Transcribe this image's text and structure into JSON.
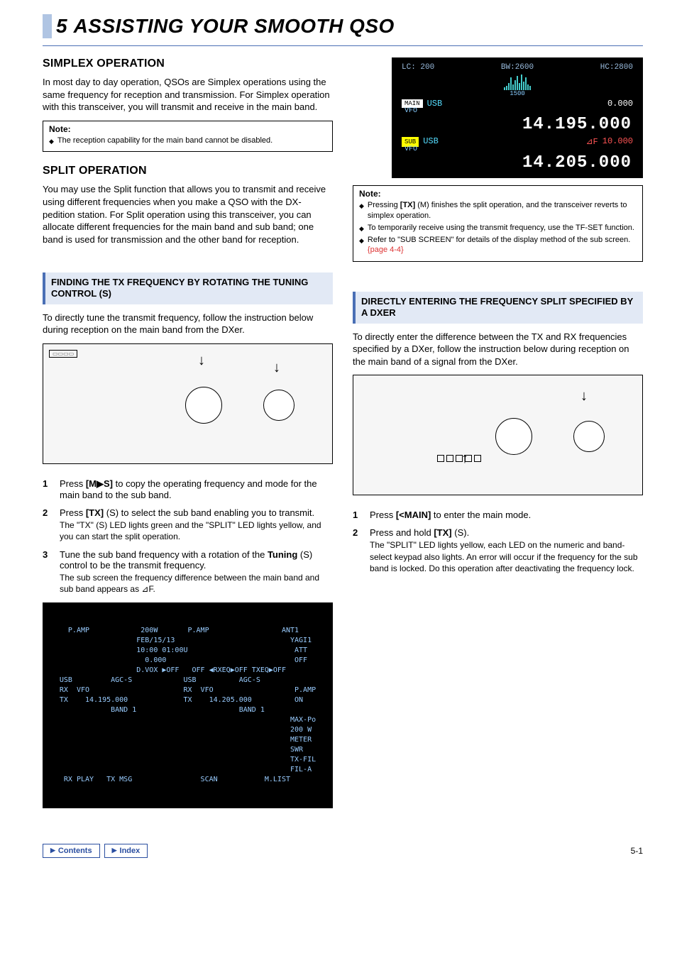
{
  "chapter": {
    "num": "5",
    "title": "ASSISTING YOUR SMOOTH QSO"
  },
  "left": {
    "sec1": {
      "title": "SIMPLEX OPERATION",
      "para": "In most day to day operation, QSOs are Simplex operations using the same frequency for reception and transmission. For Simplex operation with this transceiver, you will transmit and receive in the main band.",
      "note_title": "Note:",
      "note1": "The reception capability for the main band cannot be disabled."
    },
    "sec2": {
      "title": "SPLIT OPERATION",
      "para": "You may use the Split function that allows you to transmit and receive using different frequencies when you make a QSO with the DX-pedition station. For Split operation using this transceiver, you can allocate different frequencies for the main band and sub band; one band is used for transmission and the other band for reception."
    },
    "sub1": {
      "title": "FINDING THE TX FREQUENCY BY ROTATING THE TUNING CONTROL (S)",
      "para": "To directly tune the transmit frequency, follow the instruction below during reception on the main band from the DXer."
    },
    "step1": {
      "n": "1",
      "t1": "Press ",
      "key": "[M▶S]",
      "t2": " to copy the operating frequency and mode for the main band to the sub band."
    },
    "step2": {
      "n": "2",
      "t1": "Press ",
      "key": "[TX]",
      "t2": " (S) to select the sub band enabling you to transmit.",
      "sub": "The \"TX\" (S) LED lights green and the \"SPLIT\" LED lights yellow, and you can start the split operation."
    },
    "step3": {
      "n": "3",
      "t1": "Tune the sub band frequency with a rotation of the ",
      "key": "Tuning",
      "t2": " (S) control to be the transmit frequency.",
      "sub": "The sub screen the frequency difference between the main band and sub band appears as ⊿F."
    }
  },
  "lcd": {
    "top1": "LC: 200",
    "top2": "BW:2600",
    "top3": "HC:2800",
    "tick": "1500",
    "main_tag": "MAIN",
    "sub_tag": "SUB",
    "mode": "USB",
    "vfo": "VFO",
    "main_right": "0.000",
    "main_freq": "14.195.000",
    "df_lbl": "⊿F",
    "df_val": "10.000",
    "sub_freq": "14.205.000"
  },
  "right": {
    "note_title": "Note:",
    "note1a": "Pressing ",
    "note1_key": "[TX]",
    "note1b": " (M) finishes the split operation, and the transceiver reverts to simplex operation.",
    "note2": "To temporarily receive using the transmit frequency, use the TF-SET function.",
    "note3a": "Refer to \"SUB SCREEN\" for details of the display method of the sub screen. ",
    "note3_ref": "{page 4-4}",
    "sub2": {
      "title": "DIRECTLY ENTERING THE FREQUENCY SPLIT SPECIFIED BY A DXER",
      "para": "To directly enter the difference between the TX and RX frequencies specified by a DXer, follow the instruction below during reception on the main band of a signal from the DXer."
    },
    "step1": {
      "n": "1",
      "t1": "Press ",
      "key": "[<MAIN]",
      "t2": " to enter the main mode."
    },
    "step2": {
      "n": "2",
      "t1": "Press and hold ",
      "key": "[TX]",
      "t2": " (S).",
      "sub": "The \"SPLIT\" LED lights yellow, each LED on the numeric and band-select keypad also lights. An error will occur if the frequency for the sub band is locked. Do this operation after deactivating the frequency lock."
    }
  },
  "screen": {
    "txt": "  P.AMP            200W       P.AMP                 ANT1\n                  FEB/15/13                           YAGI1\n                  10:00 01:00U                         ATT\n                    0.000                              OFF\n                  D.VOX ▶OFF   OFF ◀RXEQ▶OFF TXEQ▶OFF\nUSB         AGC-S            USB          AGC-S\nRX  VFO                      RX  VFO                   P.AMP\nTX    14.195.000             TX    14.205.000          ON\n            BAND 1                        BAND 1\n                                                      MAX-Po\n                                                      200 W\n                                                      METER\n                                                      SWR\n                                                      TX-FIL\n                                                      FIL-A\n RX PLAY   TX MSG                SCAN           M.LIST"
  },
  "footer": {
    "contents": "Contents",
    "index": "Index",
    "page": "5-1"
  }
}
